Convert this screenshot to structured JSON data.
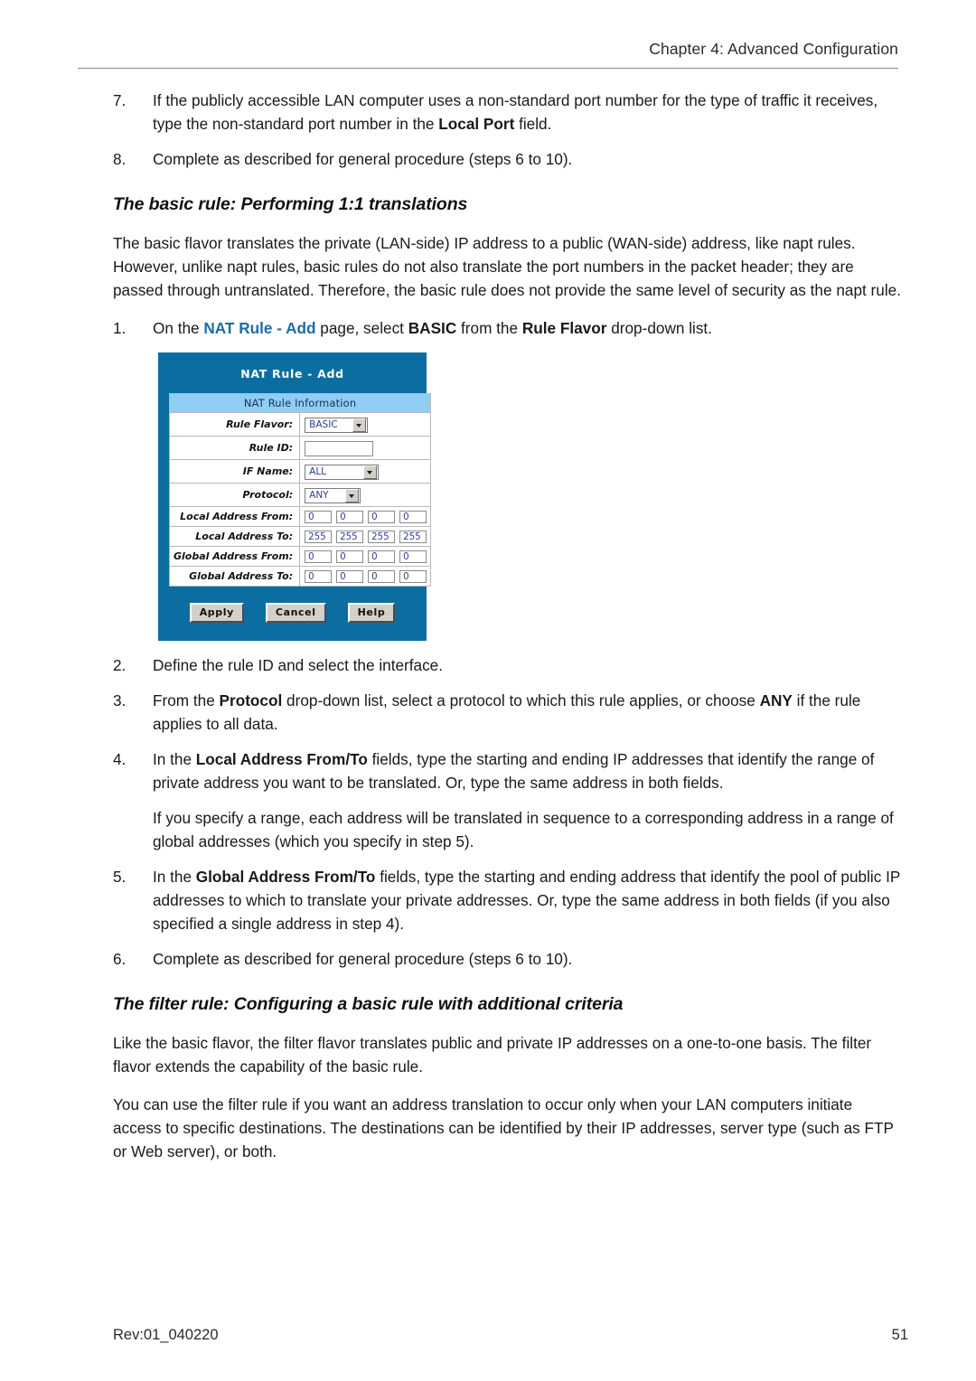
{
  "header": {
    "chapter": "Chapter 4: Advanced Configuration"
  },
  "steps_top": [
    {
      "num": "7.",
      "parts": [
        {
          "t": "If the publicly accessible LAN computer uses a non-standard port number for the type of traffic it receives, type the non-standard port number in the ",
          "style": "normal"
        },
        {
          "t": "Local Port",
          "style": "bold"
        },
        {
          "t": " field.",
          "style": "normal"
        }
      ]
    },
    {
      "num": "8.",
      "parts": [
        {
          "t": "Complete as described for general procedure (steps 6 to 10).",
          "style": "normal"
        }
      ]
    }
  ],
  "section1": {
    "heading": "The basic rule: Performing 1:1 translations",
    "intro": "The basic flavor translates the private (LAN-side) IP address to a public (WAN-side) address, like napt rules. However, unlike napt rules, basic rules do not also translate the port numbers in the packet header; they are passed through untranslated. Therefore, the basic rule does not provide the same level of security as the napt rule.",
    "step1": {
      "num": "1.",
      "parts": [
        {
          "t": "On the ",
          "style": "normal"
        },
        {
          "t": "NAT Rule - Add",
          "style": "link"
        },
        {
          "t": " page, select ",
          "style": "normal"
        },
        {
          "t": "BASIC",
          "style": "bold"
        },
        {
          "t": " from the ",
          "style": "normal"
        },
        {
          "t": "Rule Flavor",
          "style": "bold"
        },
        {
          "t": " drop-down list.",
          "style": "normal"
        }
      ]
    },
    "steps_after": [
      {
        "num": "2.",
        "parts": [
          {
            "t": "Define the rule ID and select the interface.",
            "style": "normal"
          }
        ]
      },
      {
        "num": "3.",
        "parts": [
          {
            "t": "From the ",
            "style": "normal"
          },
          {
            "t": "Protocol",
            "style": "bold"
          },
          {
            "t": " drop-down list, select a protocol to which this rule applies, or choose ",
            "style": "normal"
          },
          {
            "t": "ANY",
            "style": "bold"
          },
          {
            "t": " if the rule applies to all data.",
            "style": "normal"
          }
        ]
      },
      {
        "num": "4.",
        "parts": [
          {
            "t": "In the ",
            "style": "normal"
          },
          {
            "t": "Local Address From/To",
            "style": "bold"
          },
          {
            "t": " fields, type the starting and ending IP addresses that identify the range of private address you want to be translated. Or, type the same address in both fields.",
            "style": "normal"
          }
        ]
      }
    ],
    "note_after_4": "If you specify a range, each address will be translated in sequence to a corresponding address in a range of global addresses (which you specify in step 5).",
    "steps_tail": [
      {
        "num": "5.",
        "parts": [
          {
            "t": "In the ",
            "style": "normal"
          },
          {
            "t": "Global Address From/To",
            "style": "bold"
          },
          {
            "t": " fields, type the starting and ending address that identify the pool of public IP addresses to which to translate your private addresses. Or, type the same address in both fields (if you also specified a single address in step 4).",
            "style": "normal"
          }
        ]
      },
      {
        "num": "6.",
        "parts": [
          {
            "t": "Complete as described for general procedure (steps 6 to 10).",
            "style": "normal"
          }
        ]
      }
    ]
  },
  "nat_dialog": {
    "title": "NAT Rule - Add",
    "section_header": "NAT Rule Information",
    "fields": [
      {
        "label": "Rule Flavor:",
        "widget": "select",
        "value": "BASIC"
      },
      {
        "label": "Rule ID:",
        "widget": "text",
        "value": ""
      },
      {
        "label": "IF Name:",
        "widget": "select",
        "value": "ALL"
      },
      {
        "label": "Protocol:",
        "widget": "select",
        "value": "ANY"
      },
      {
        "label": "Local Address From:",
        "widget": "octets",
        "value": [
          "0",
          "0",
          "0",
          "0"
        ]
      },
      {
        "label": "Local Address To:",
        "widget": "octets",
        "value": [
          "255",
          "255",
          "255",
          "255"
        ]
      },
      {
        "label": "Global Address From:",
        "widget": "octets",
        "value": [
          "0",
          "0",
          "0",
          "0"
        ]
      },
      {
        "label": "Global Address To:",
        "widget": "octets",
        "value": [
          "0",
          "0",
          "0",
          "0"
        ]
      }
    ],
    "buttons": [
      "Apply",
      "Cancel",
      "Help"
    ],
    "colors": {
      "dialog_bg": "#0c6ea0",
      "section_header_bg": "#8fcdf5",
      "field_text": "#2b3f86",
      "button_face": "#d4d0c8"
    }
  },
  "section2": {
    "heading": "The filter rule: Configuring a basic rule with additional criteria",
    "para1": "Like the basic flavor, the filter flavor translates public and private IP addresses on a one-to-one basis. The filter flavor extends the capability of the basic rule.",
    "para2": "You can use the filter rule if you want an address translation to occur only when your LAN computers initiate access to specific destinations. The destinations can be identified by their IP addresses, server type (such as FTP or Web server), or both."
  },
  "footer": {
    "revision": "Rev:01_040220",
    "page_number": "51"
  }
}
